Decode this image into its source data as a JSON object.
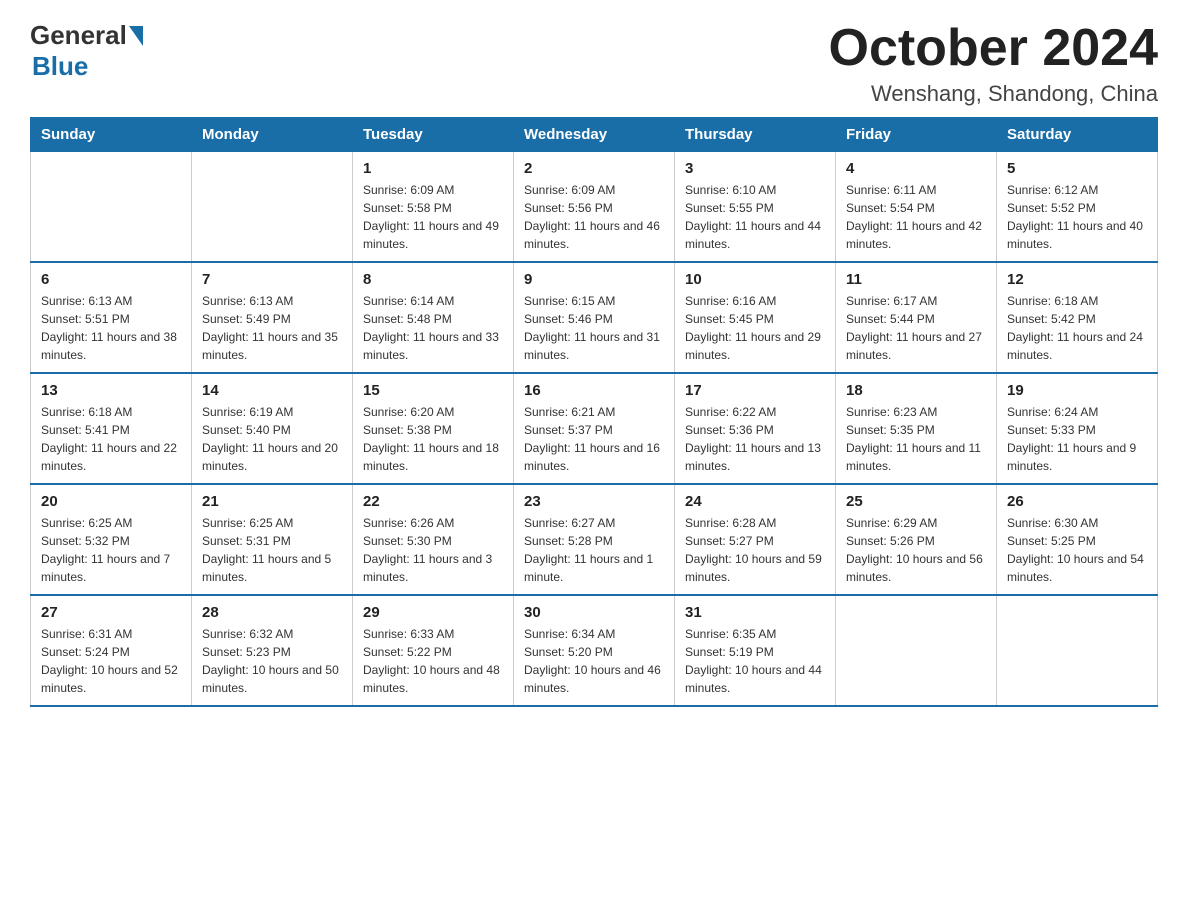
{
  "header": {
    "logo_general": "General",
    "logo_blue": "Blue",
    "month_title": "October 2024",
    "location": "Wenshang, Shandong, China"
  },
  "weekdays": [
    "Sunday",
    "Monday",
    "Tuesday",
    "Wednesday",
    "Thursday",
    "Friday",
    "Saturday"
  ],
  "weeks": [
    [
      {
        "day": "",
        "sunrise": "",
        "sunset": "",
        "daylight": ""
      },
      {
        "day": "",
        "sunrise": "",
        "sunset": "",
        "daylight": ""
      },
      {
        "day": "1",
        "sunrise": "Sunrise: 6:09 AM",
        "sunset": "Sunset: 5:58 PM",
        "daylight": "Daylight: 11 hours and 49 minutes."
      },
      {
        "day": "2",
        "sunrise": "Sunrise: 6:09 AM",
        "sunset": "Sunset: 5:56 PM",
        "daylight": "Daylight: 11 hours and 46 minutes."
      },
      {
        "day": "3",
        "sunrise": "Sunrise: 6:10 AM",
        "sunset": "Sunset: 5:55 PM",
        "daylight": "Daylight: 11 hours and 44 minutes."
      },
      {
        "day": "4",
        "sunrise": "Sunrise: 6:11 AM",
        "sunset": "Sunset: 5:54 PM",
        "daylight": "Daylight: 11 hours and 42 minutes."
      },
      {
        "day": "5",
        "sunrise": "Sunrise: 6:12 AM",
        "sunset": "Sunset: 5:52 PM",
        "daylight": "Daylight: 11 hours and 40 minutes."
      }
    ],
    [
      {
        "day": "6",
        "sunrise": "Sunrise: 6:13 AM",
        "sunset": "Sunset: 5:51 PM",
        "daylight": "Daylight: 11 hours and 38 minutes."
      },
      {
        "day": "7",
        "sunrise": "Sunrise: 6:13 AM",
        "sunset": "Sunset: 5:49 PM",
        "daylight": "Daylight: 11 hours and 35 minutes."
      },
      {
        "day": "8",
        "sunrise": "Sunrise: 6:14 AM",
        "sunset": "Sunset: 5:48 PM",
        "daylight": "Daylight: 11 hours and 33 minutes."
      },
      {
        "day": "9",
        "sunrise": "Sunrise: 6:15 AM",
        "sunset": "Sunset: 5:46 PM",
        "daylight": "Daylight: 11 hours and 31 minutes."
      },
      {
        "day": "10",
        "sunrise": "Sunrise: 6:16 AM",
        "sunset": "Sunset: 5:45 PM",
        "daylight": "Daylight: 11 hours and 29 minutes."
      },
      {
        "day": "11",
        "sunrise": "Sunrise: 6:17 AM",
        "sunset": "Sunset: 5:44 PM",
        "daylight": "Daylight: 11 hours and 27 minutes."
      },
      {
        "day": "12",
        "sunrise": "Sunrise: 6:18 AM",
        "sunset": "Sunset: 5:42 PM",
        "daylight": "Daylight: 11 hours and 24 minutes."
      }
    ],
    [
      {
        "day": "13",
        "sunrise": "Sunrise: 6:18 AM",
        "sunset": "Sunset: 5:41 PM",
        "daylight": "Daylight: 11 hours and 22 minutes."
      },
      {
        "day": "14",
        "sunrise": "Sunrise: 6:19 AM",
        "sunset": "Sunset: 5:40 PM",
        "daylight": "Daylight: 11 hours and 20 minutes."
      },
      {
        "day": "15",
        "sunrise": "Sunrise: 6:20 AM",
        "sunset": "Sunset: 5:38 PM",
        "daylight": "Daylight: 11 hours and 18 minutes."
      },
      {
        "day": "16",
        "sunrise": "Sunrise: 6:21 AM",
        "sunset": "Sunset: 5:37 PM",
        "daylight": "Daylight: 11 hours and 16 minutes."
      },
      {
        "day": "17",
        "sunrise": "Sunrise: 6:22 AM",
        "sunset": "Sunset: 5:36 PM",
        "daylight": "Daylight: 11 hours and 13 minutes."
      },
      {
        "day": "18",
        "sunrise": "Sunrise: 6:23 AM",
        "sunset": "Sunset: 5:35 PM",
        "daylight": "Daylight: 11 hours and 11 minutes."
      },
      {
        "day": "19",
        "sunrise": "Sunrise: 6:24 AM",
        "sunset": "Sunset: 5:33 PM",
        "daylight": "Daylight: 11 hours and 9 minutes."
      }
    ],
    [
      {
        "day": "20",
        "sunrise": "Sunrise: 6:25 AM",
        "sunset": "Sunset: 5:32 PM",
        "daylight": "Daylight: 11 hours and 7 minutes."
      },
      {
        "day": "21",
        "sunrise": "Sunrise: 6:25 AM",
        "sunset": "Sunset: 5:31 PM",
        "daylight": "Daylight: 11 hours and 5 minutes."
      },
      {
        "day": "22",
        "sunrise": "Sunrise: 6:26 AM",
        "sunset": "Sunset: 5:30 PM",
        "daylight": "Daylight: 11 hours and 3 minutes."
      },
      {
        "day": "23",
        "sunrise": "Sunrise: 6:27 AM",
        "sunset": "Sunset: 5:28 PM",
        "daylight": "Daylight: 11 hours and 1 minute."
      },
      {
        "day": "24",
        "sunrise": "Sunrise: 6:28 AM",
        "sunset": "Sunset: 5:27 PM",
        "daylight": "Daylight: 10 hours and 59 minutes."
      },
      {
        "day": "25",
        "sunrise": "Sunrise: 6:29 AM",
        "sunset": "Sunset: 5:26 PM",
        "daylight": "Daylight: 10 hours and 56 minutes."
      },
      {
        "day": "26",
        "sunrise": "Sunrise: 6:30 AM",
        "sunset": "Sunset: 5:25 PM",
        "daylight": "Daylight: 10 hours and 54 minutes."
      }
    ],
    [
      {
        "day": "27",
        "sunrise": "Sunrise: 6:31 AM",
        "sunset": "Sunset: 5:24 PM",
        "daylight": "Daylight: 10 hours and 52 minutes."
      },
      {
        "day": "28",
        "sunrise": "Sunrise: 6:32 AM",
        "sunset": "Sunset: 5:23 PM",
        "daylight": "Daylight: 10 hours and 50 minutes."
      },
      {
        "day": "29",
        "sunrise": "Sunrise: 6:33 AM",
        "sunset": "Sunset: 5:22 PM",
        "daylight": "Daylight: 10 hours and 48 minutes."
      },
      {
        "day": "30",
        "sunrise": "Sunrise: 6:34 AM",
        "sunset": "Sunset: 5:20 PM",
        "daylight": "Daylight: 10 hours and 46 minutes."
      },
      {
        "day": "31",
        "sunrise": "Sunrise: 6:35 AM",
        "sunset": "Sunset: 5:19 PM",
        "daylight": "Daylight: 10 hours and 44 minutes."
      },
      {
        "day": "",
        "sunrise": "",
        "sunset": "",
        "daylight": ""
      },
      {
        "day": "",
        "sunrise": "",
        "sunset": "",
        "daylight": ""
      }
    ]
  ]
}
